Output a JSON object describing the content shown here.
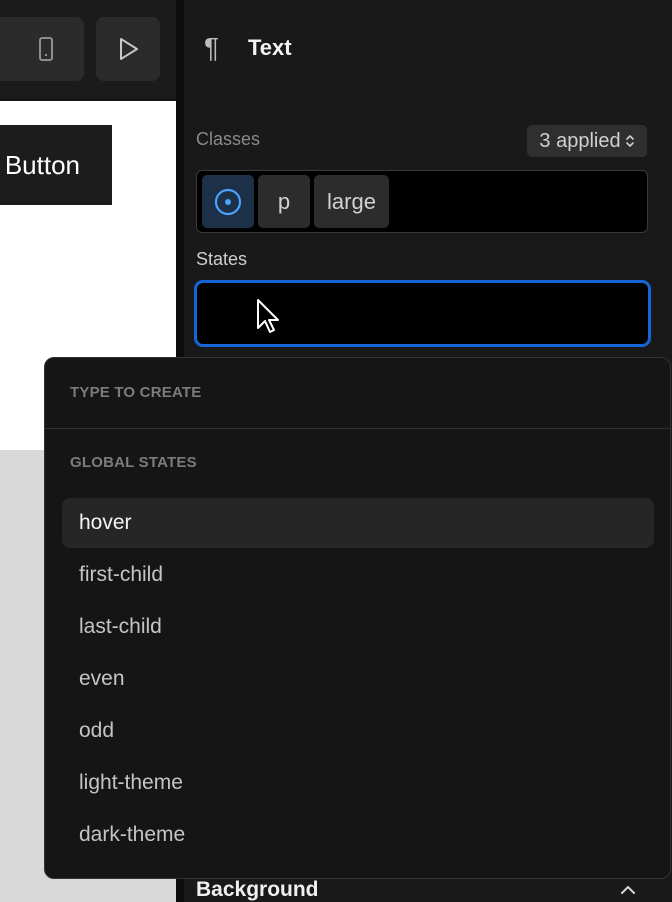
{
  "canvas": {
    "button_text": "Button"
  },
  "panel": {
    "title": "Text",
    "classes_label": "Classes",
    "applied_badge": "3 applied",
    "chips": [
      "p",
      "large"
    ],
    "states_label": "States",
    "states_input_value": "",
    "section_background": "Background"
  },
  "dropdown": {
    "type_to_create": "TYPE TO CREATE",
    "global_states": "GLOBAL STATES",
    "items": [
      "hover",
      "first-child",
      "last-child",
      "even",
      "odd",
      "light-theme",
      "dark-theme"
    ],
    "active_item": "hover"
  },
  "colors": {
    "accent_blue": "#1565d8",
    "state_icon_blue": "#4aa3ff",
    "panel_bg": "#191919"
  },
  "icons": {
    "pilcrow": "pilcrow-icon",
    "device": "mobile-device-icon",
    "play": "play-icon",
    "state": "state-circle-icon",
    "sort": "up-down-chevron-icon",
    "cursor": "mouse-pointer-icon",
    "collapse": "chevron-up-icon"
  }
}
